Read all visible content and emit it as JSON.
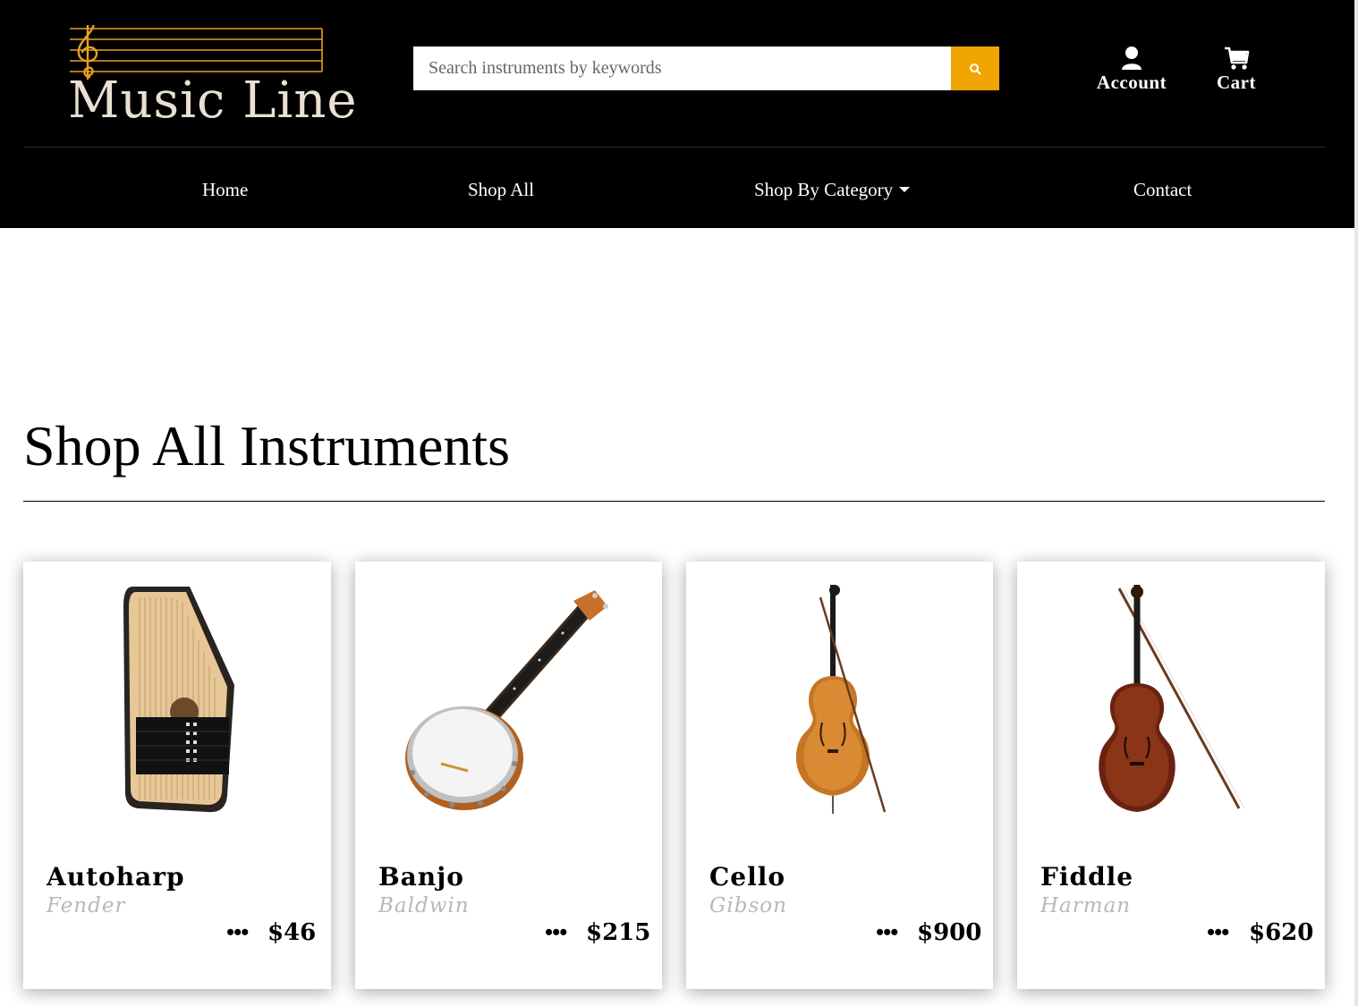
{
  "brand": {
    "logo_text": "Music Line",
    "logo_icon": "treble-clef-staff",
    "accent_color": "#e8a020"
  },
  "search": {
    "placeholder": "Search instruments by keywords",
    "value": "",
    "button_icon": "search-icon",
    "button_color": "#f0a500"
  },
  "header_actions": {
    "account_label": "Account",
    "account_icon": "user-icon",
    "cart_label": "Cart",
    "cart_icon": "cart-icon"
  },
  "nav": {
    "home": "Home",
    "shop_all": "Shop All",
    "shop_by_category": "Shop By Category",
    "contact": "Contact"
  },
  "main": {
    "title": "Shop All Instruments"
  },
  "products": [
    {
      "name": "Autoharp",
      "brand": "Fender",
      "price": "$46",
      "more": "•••",
      "image": "autoharp"
    },
    {
      "name": "Banjo",
      "brand": "Baldwin",
      "price": "$215",
      "more": "•••",
      "image": "banjo"
    },
    {
      "name": "Cello",
      "brand": "Gibson",
      "price": "$900",
      "more": "•••",
      "image": "cello"
    },
    {
      "name": "Fiddle",
      "brand": "Harman",
      "price": "$620",
      "more": "•••",
      "image": "fiddle"
    }
  ]
}
